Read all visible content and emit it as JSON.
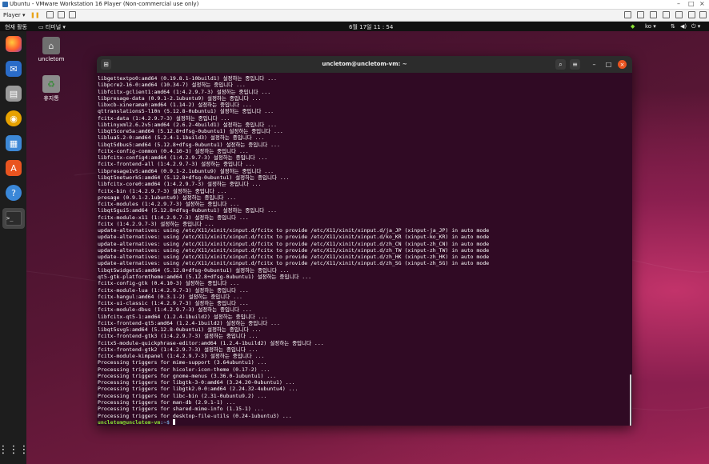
{
  "vmware": {
    "title": "Ubuntu - VMware Workstation 16 Player (Non-commercial use only)",
    "player_menu": "Player ▾"
  },
  "topbar": {
    "input_mode": "현재 활동",
    "app_menu": "터미널 ▾",
    "clock": "6월 17일 11 : 54",
    "lang": "ko ▾"
  },
  "desktop_icons": [
    {
      "label": "uncletom"
    },
    {
      "label": "휴지통"
    }
  ],
  "terminal": {
    "title": "uncletom@uncletom-vm: ~",
    "lines": [
      "libgettextpo0:amd64 (0.19.8.1-10build1) 설정하는 중입니다 ...",
      "libpcre2-16-0:amd64 (10.34-7) 설정하는 중입니다 ...",
      "libfcitx-gclient1:amd64 (1:4.2.9.7-3) 설정하는 중입니다 ...",
      "libpresage-data (0.9.1-2.1ubuntu9) 설정하는 중입니다 ...",
      "libxcb-xinerama0:amd64 (1.14-2) 설정하는 중입니다 ...",
      "qttranslations5-l10n (5.12.8-0ubuntu1) 설정하는 중입니다 ...",
      "fcitx-data (1:4.2.9.7-3) 설정하는 중입니다 ...",
      "libtinyxml2.6.2v5:amd64 (2.6.2-4build1) 설정하는 중입니다 ...",
      "libqt5core5a:amd64 (5.12.8+dfsg-0ubuntu1) 설정하는 중입니다 ...",
      "liblua5.2-0:amd64 (5.2.4-1.1build3) 설정하는 중입니다 ...",
      "libqt5dbus5:amd64 (5.12.8+dfsg-0ubuntu1) 설정하는 중입니다 ...",
      "fcitx-config-common (0.4.10-3) 설정하는 중입니다 ...",
      "libfcitx-config4:amd64 (1:4.2.9.7-3) 설정하는 중입니다 ...",
      "fcitx-frontend-all (1:4.2.9.7-3) 설정하는 중입니다 ...",
      "libpresage1v5:amd64 (0.9.1-2.1ubuntu9) 설정하는 중입니다 ...",
      "libqt5network5:amd64 (5.12.8+dfsg-0ubuntu1) 설정하는 중입니다 ...",
      "libfcitx-core0:amd64 (1:4.2.9.7-3) 설정하는 중입니다 ...",
      "fcitx-bin (1:4.2.9.7-3) 설정하는 중입니다 ...",
      "presage (0.9.1-2.1ubuntu9) 설정하는 중입니다 ...",
      "fcitx-modules (1:4.2.9.7-3) 설정하는 중입니다 ...",
      "libqt5gui5:amd64 (5.12.8+dfsg-0ubuntu1) 설정하는 중입니다 ...",
      "fcitx-module-x11 (1:4.2.9.7-3) 설정하는 중입니다 ...",
      "fcitx (1:4.2.9.7-3) 설정하는 중입니다 ...",
      "update-alternatives: using /etc/X11/xinit/xinput.d/fcitx to provide /etc/X11/xinit/xinput.d/ja_JP (xinput-ja_JP) in auto mode",
      "update-alternatives: using /etc/X11/xinit/xinput.d/fcitx to provide /etc/X11/xinit/xinput.d/ko_KR (xinput-ko_KR) in auto mode",
      "update-alternatives: using /etc/X11/xinit/xinput.d/fcitx to provide /etc/X11/xinit/xinput.d/zh_CN (xinput-zh_CN) in auto mode",
      "update-alternatives: using /etc/X11/xinit/xinput.d/fcitx to provide /etc/X11/xinit/xinput.d/zh_TW (xinput-zh_TW) in auto mode",
      "update-alternatives: using /etc/X11/xinit/xinput.d/fcitx to provide /etc/X11/xinit/xinput.d/zh_HK (xinput-zh_HK) in auto mode",
      "update-alternatives: using /etc/X11/xinit/xinput.d/fcitx to provide /etc/X11/xinit/xinput.d/zh_SG (xinput-zh_SG) in auto mode",
      "libqt5widgets5:amd64 (5.12.8+dfsg-0ubuntu1) 설정하는 중입니다 ...",
      "qt5-gtk-platformtheme:amd64 (5.12.8+dfsg-0ubuntu1) 설정하는 중입니다 ...",
      "fcitx-config-gtk (0.4.10-3) 설정하는 중입니다 ...",
      "fcitx-module-lua (1:4.2.9.7-3) 설정하는 중입니다 ...",
      "fcitx-hangul:amd64 (0.3.1-2) 설정하는 중입니다 ...",
      "fcitx-ui-classic (1:4.2.9.7-3) 설정하는 중입니다 ...",
      "fcitx-module-dbus (1:4.2.9.7-3) 설정하는 중입니다 ...",
      "libfcitx-qt5-1:amd64 (1.2.4-1build2) 설정하는 중입니다 ...",
      "fcitx-frontend-qt5:amd64 (1.2.4-1build2) 설정하는 중입니다 ...",
      "libqt5svg5:amd64 (5.12.8-0ubuntu1) 설정하는 중입니다 ...",
      "fcitx-frontend-gtk3 (1:4.2.9.7-3) 설정하는 중입니다 ...",
      "fcitx5-module-quickphrase-editor:amd64 (1.2.4-1build2) 설정하는 중입니다 ...",
      "fcitx-frontend-gtk2 (1:4.2.9.7-3) 설정하는 중입니다 ...",
      "fcitx-module-kimpanel (1:4.2.9.7-3) 설정하는 중입니다 ...",
      "Processing triggers for mime-support (3.64ubuntu1) ...",
      "Processing triggers for hicolor-icon-theme (0.17-2) ...",
      "Processing triggers for gnome-menus (3.36.0-1ubuntu1) ...",
      "Processing triggers for libgtk-3-0:amd64 (3.24.20-0ubuntu1) ...",
      "Processing triggers for libgtk2.0-0:amd64 (2.24.32-4ubuntu4) ...",
      "Processing triggers for libc-bin (2.31-0ubuntu9.2) ...",
      "Processing triggers for man-db (2.9.1-1) ...",
      "Processing triggers for shared-mime-info (1.15-1) ...",
      "Processing triggers for desktop-file-utils (0.24-1ubuntu3) ..."
    ],
    "prompt_user": "uncletom@uncletom-vm",
    "prompt_path": ":~$"
  },
  "colors": {
    "terminal_bg": "#300a24",
    "prompt_user": "#8ae234",
    "prompt_path": "#729fcf",
    "close_button": "#e95420"
  }
}
